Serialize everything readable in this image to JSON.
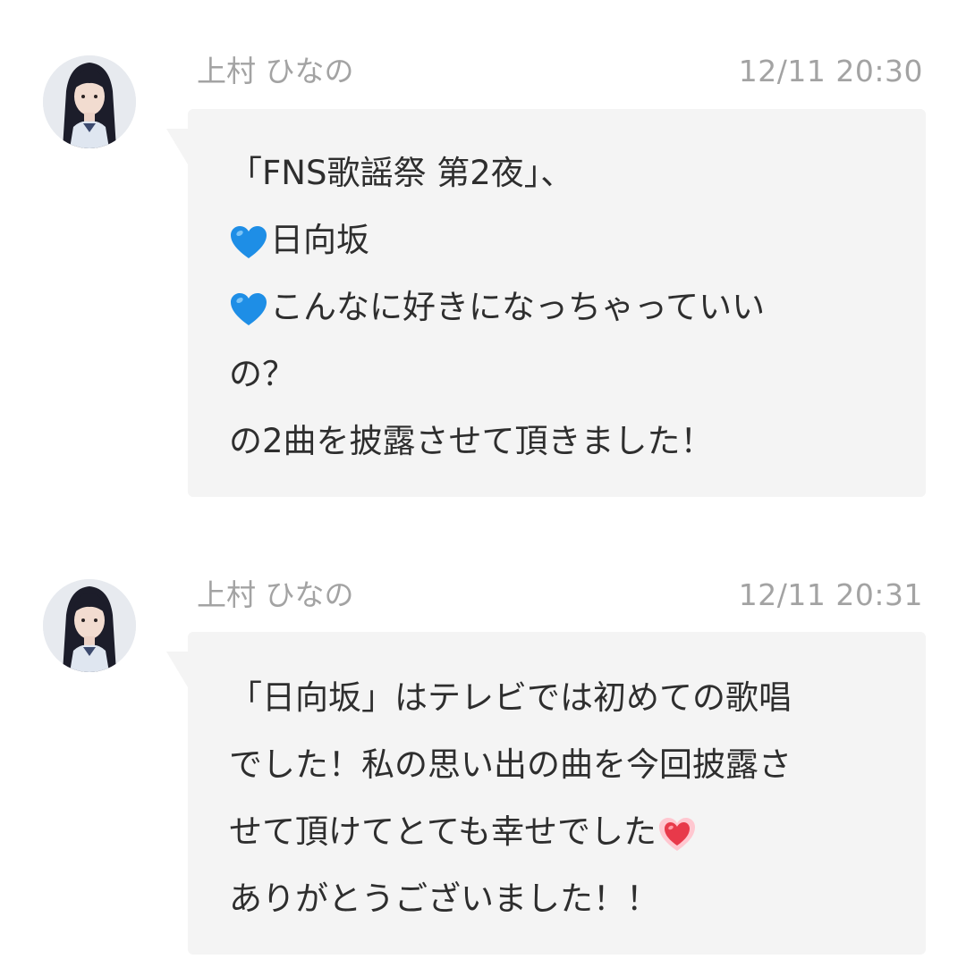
{
  "colors": {
    "name_text": "#a3a3a3",
    "bubble_bg": "#f4f4f4",
    "message_text": "#2e2e2e",
    "blue_heart": "#1e8ee6",
    "red_heart": "#e8394a"
  },
  "messages": [
    {
      "sender": "上村 ひなの",
      "timestamp": "12/11 20:30",
      "avatar_icon": "member-portrait",
      "lines": [
        {
          "text": "「FNS歌謡祭 第2夜」、"
        },
        {
          "emoji": "blue-heart-icon",
          "text": "日向坂"
        },
        {
          "emoji": "blue-heart-icon",
          "text": "こんなに好きになっちゃっていい"
        },
        {
          "text": "の？"
        },
        {
          "text": "の2曲を披露させて頂きました！"
        }
      ]
    },
    {
      "sender": "上村 ひなの",
      "timestamp": "12/11 20:31",
      "avatar_icon": "member-portrait",
      "lines": [
        {
          "text": "「日向坂」はテレビでは初めての歌唱"
        },
        {
          "text": "でした！私の思い出の曲を今回披露さ"
        },
        {
          "text": "せて頂けてとても幸せでした",
          "emoji_after": "red-heart-icon"
        },
        {
          "text": "ありがとうございました！！"
        }
      ]
    }
  ]
}
